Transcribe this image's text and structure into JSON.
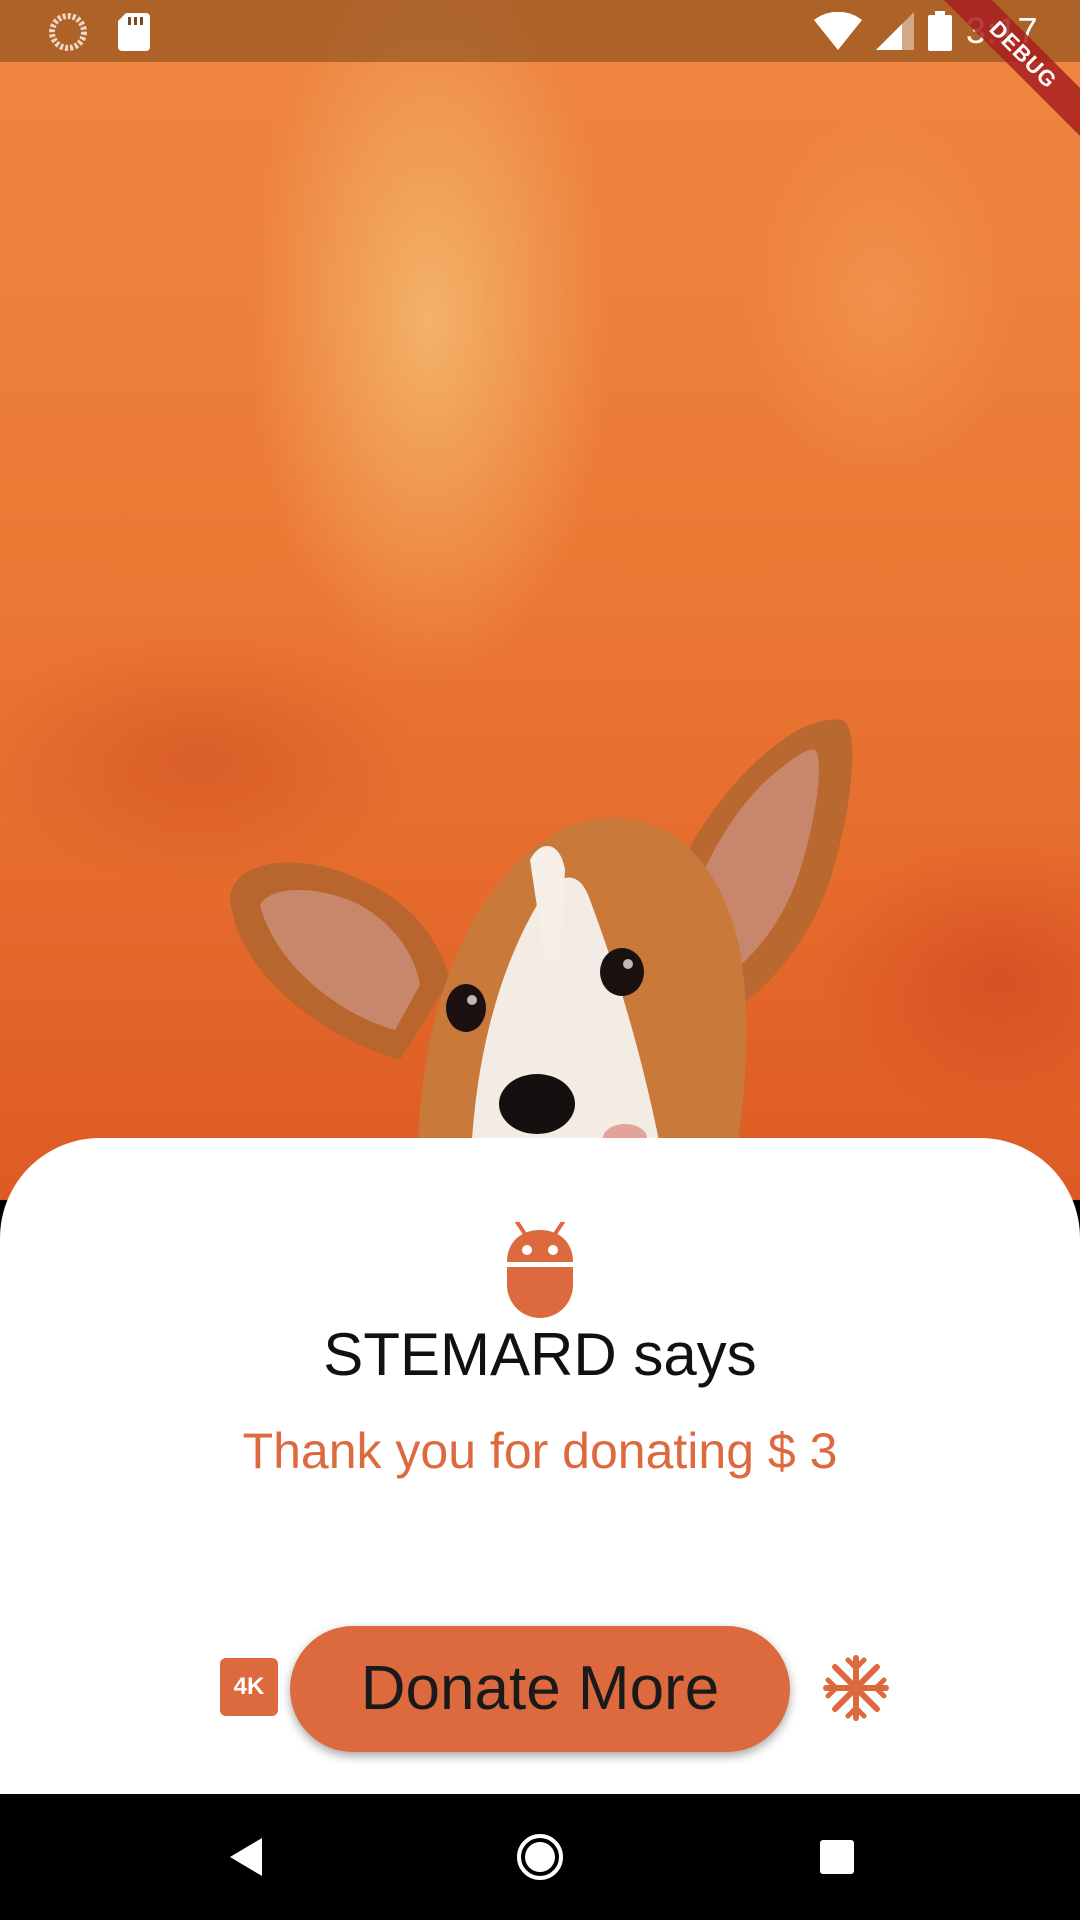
{
  "status_bar": {
    "time": "3:17",
    "icons": [
      "loading-circle-icon",
      "sd-card-icon",
      "wifi-icon",
      "cell-signal-icon",
      "battery-icon"
    ]
  },
  "debug_banner": "DEBUG",
  "card": {
    "icon": "android-icon",
    "title": "STEMARD says",
    "message": "Thank you for donating $ 3"
  },
  "actions": {
    "left_icon": "4k-icon",
    "left_icon_text": "4K",
    "button_label": "Donate More",
    "right_icon": "snowflake-icon"
  },
  "nav_bar": {
    "buttons": [
      "back-icon",
      "home-icon",
      "recents-icon"
    ]
  },
  "colors": {
    "accent": "#dd6a3f",
    "hero_background": "#ec7a35",
    "card_background": "#ffffff",
    "title_text": "#111111",
    "nav_background": "#000000"
  }
}
